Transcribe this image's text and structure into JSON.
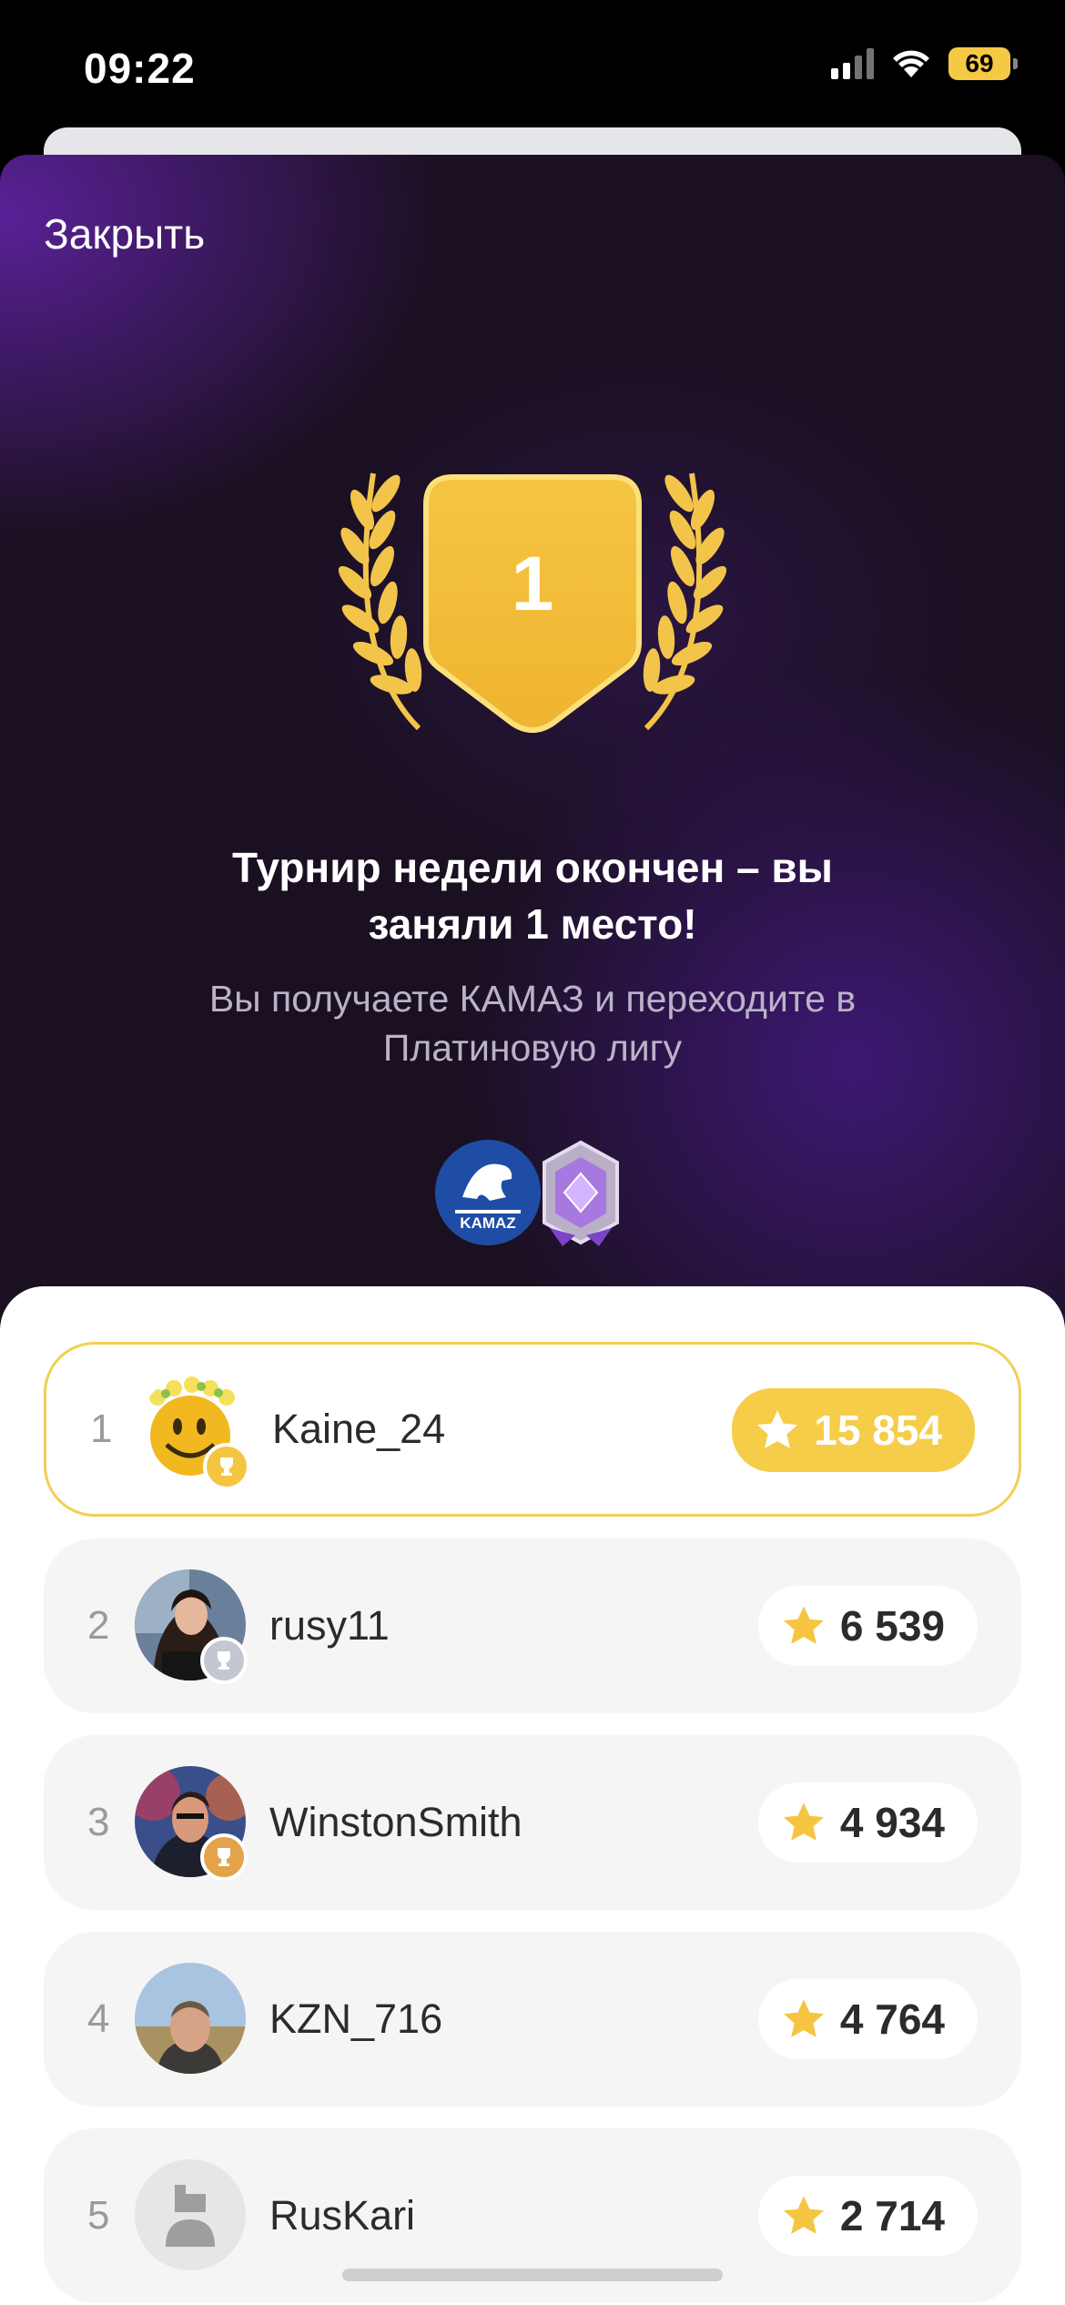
{
  "status_bar": {
    "time": "09:22",
    "battery": "69"
  },
  "modal": {
    "close_label": "Закрыть",
    "place": "1",
    "title": "Турнир недели окончен – вы заняли 1 место!",
    "subtitle": "Вы получаете КАМАЗ и переходите в Платиновую лигу",
    "reward_logo_text": "KAMAZ"
  },
  "leaderboard": [
    {
      "rank": "1",
      "name": "Kaine_24",
      "score": "15 854",
      "medal": "gold",
      "highlight": true
    },
    {
      "rank": "2",
      "name": "rusy11",
      "score": "6 539",
      "medal": "silver",
      "highlight": false
    },
    {
      "rank": "3",
      "name": "WinstonSmith",
      "score": "4 934",
      "medal": "bronze",
      "highlight": false
    },
    {
      "rank": "4",
      "name": "KZN_716",
      "score": "4 764",
      "medal": "",
      "highlight": false
    },
    {
      "rank": "5",
      "name": "RusKari",
      "score": "2 714",
      "medal": "",
      "highlight": false
    }
  ],
  "colors": {
    "gold": "#f5cd48",
    "accent_purple": "#5a2198",
    "background": "#1a1021"
  }
}
